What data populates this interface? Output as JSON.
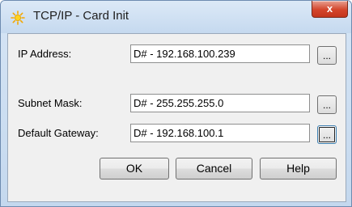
{
  "window": {
    "title": "TCP/IP - Card Init",
    "close_label": "x"
  },
  "fields": [
    {
      "label": "IP Address:",
      "value": "D# - 192.168.100.239",
      "browse_label": "..."
    },
    {
      "label": "Subnet Mask:",
      "value": "D# - 255.255.255.0",
      "browse_label": "..."
    },
    {
      "label": "Default Gateway:",
      "value": "D# - 192.168.100.1",
      "browse_label": "..."
    }
  ],
  "buttons": {
    "ok": "OK",
    "cancel": "Cancel",
    "help": "Help"
  },
  "icons": {
    "app": "sun-icon",
    "close": "close-icon"
  }
}
